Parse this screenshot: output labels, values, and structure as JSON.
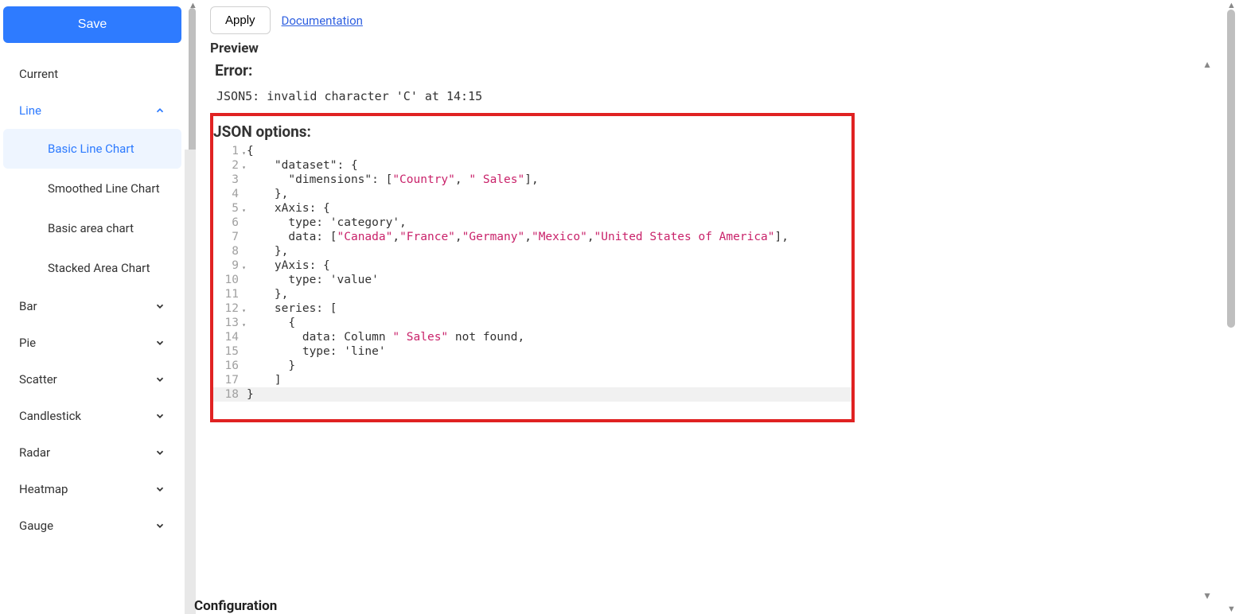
{
  "sidebar": {
    "save_label": "Save",
    "current_label": "Current",
    "line": {
      "label": "Line",
      "items": [
        "Basic Line Chart",
        "Smoothed Line Chart",
        "Basic area chart",
        "Stacked Area Chart"
      ]
    },
    "collapsed": [
      "Bar",
      "Pie",
      "Scatter",
      "Candlestick",
      "Radar",
      "Heatmap",
      "Gauge"
    ]
  },
  "top": {
    "apply": "Apply",
    "documentation": "Documentation"
  },
  "preview_title": "Preview",
  "error": {
    "title": "Error:",
    "message": "JSON5: invalid character 'C' at 14:15"
  },
  "json_options_title": "JSON options:",
  "editor": {
    "lines": [
      [
        {
          "t": "{"
        }
      ],
      [
        {
          "t": "    \"dataset\": {"
        }
      ],
      [
        {
          "t": "      \"dimensions\": ["
        },
        {
          "t": "\"Country\"",
          "c": "str"
        },
        {
          "t": ", "
        },
        {
          "t": "\" Sales\"",
          "c": "str"
        },
        {
          "t": "],"
        }
      ],
      [
        {
          "t": "    },"
        }
      ],
      [
        {
          "t": "    xAxis: {"
        }
      ],
      [
        {
          "t": "      type: 'category',"
        }
      ],
      [
        {
          "t": "      data: ["
        },
        {
          "t": "\"Canada\"",
          "c": "str"
        },
        {
          "t": ","
        },
        {
          "t": "\"France\"",
          "c": "str"
        },
        {
          "t": ","
        },
        {
          "t": "\"Germany\"",
          "c": "str"
        },
        {
          "t": ","
        },
        {
          "t": "\"Mexico\"",
          "c": "str"
        },
        {
          "t": ","
        },
        {
          "t": "\"United States of America\"",
          "c": "str"
        },
        {
          "t": "],"
        }
      ],
      [
        {
          "t": "    },"
        }
      ],
      [
        {
          "t": "    yAxis: {"
        }
      ],
      [
        {
          "t": "      type: 'value'"
        }
      ],
      [
        {
          "t": "    },"
        }
      ],
      [
        {
          "t": "    series: ["
        }
      ],
      [
        {
          "t": "      {"
        }
      ],
      [
        {
          "t": "        data: Column "
        },
        {
          "t": "\" Sales\"",
          "c": "str"
        },
        {
          "t": " not found,"
        }
      ],
      [
        {
          "t": "        type: 'line'"
        }
      ],
      [
        {
          "t": "      }"
        }
      ],
      [
        {
          "t": "    ]"
        }
      ],
      [
        {
          "t": "}"
        }
      ]
    ],
    "fold_lines": [
      1,
      2,
      5,
      9,
      12,
      13
    ],
    "active_line": 18
  },
  "config_cut": "Configuration"
}
